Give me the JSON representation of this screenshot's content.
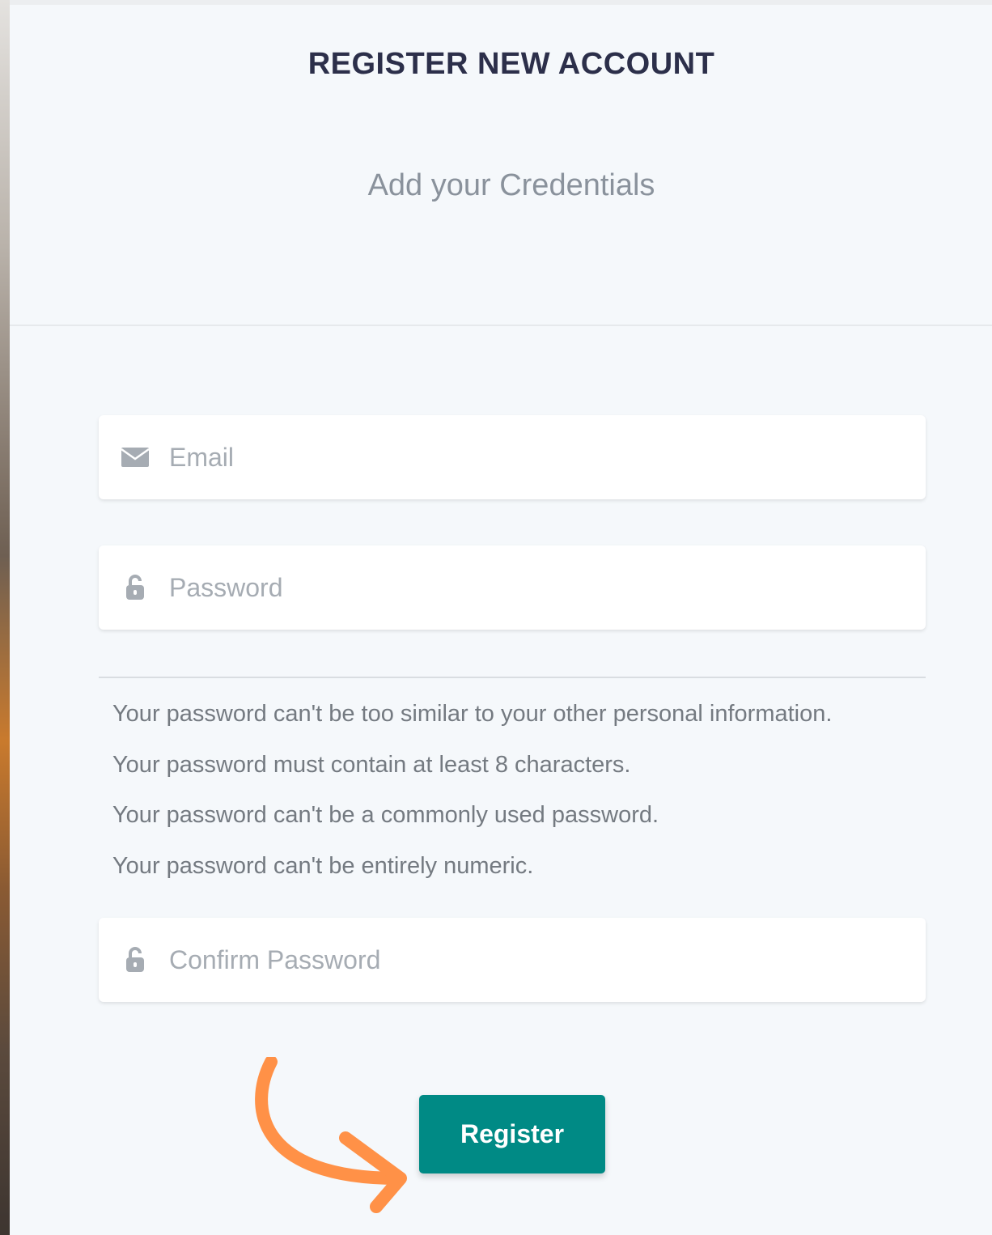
{
  "form": {
    "title": "REGISTER NEW ACCOUNT",
    "subtitle": "Add your Credentials",
    "email_placeholder": "Email",
    "password_placeholder": "Password",
    "confirm_placeholder": "Confirm Password",
    "password_rules": [
      "Your password can't be too similar to your other personal information.",
      "Your password must contain at least 8 characters.",
      "Your password can't be a commonly used password.",
      "Your password can't be entirely numeric."
    ],
    "register_label": "Register"
  },
  "icons": {
    "email": "envelope-icon",
    "password": "lock-icon",
    "confirm": "lock-icon",
    "annotation": "curved-arrow-icon"
  },
  "colors": {
    "primary": "#008a85",
    "arrow": "#ff9147",
    "title": "#2c2f4a",
    "muted": "#a6acb3"
  }
}
